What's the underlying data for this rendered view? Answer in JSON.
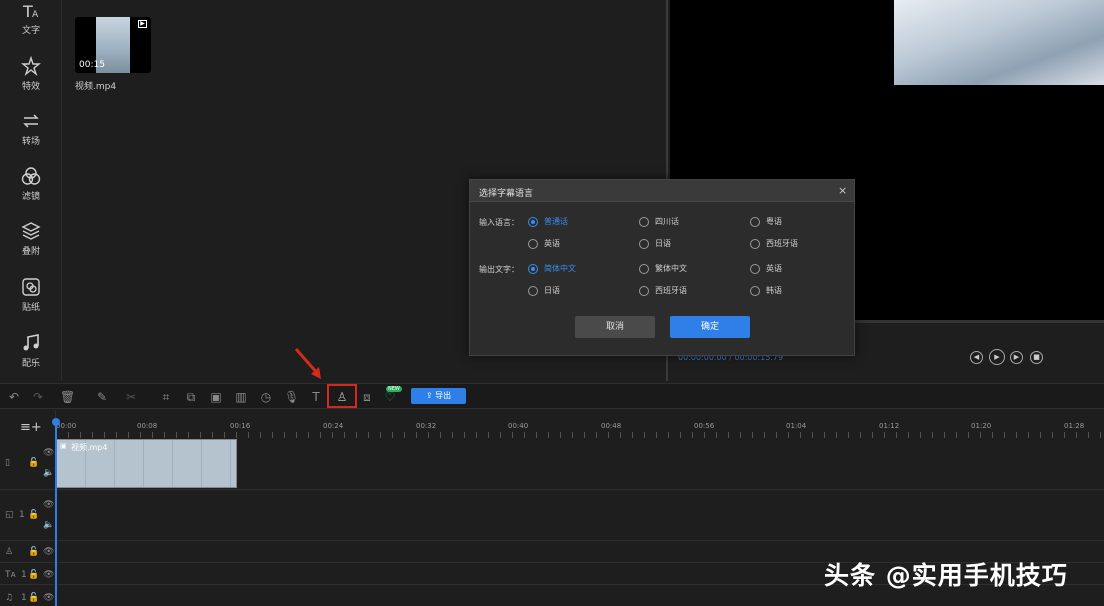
{
  "sidebar": {
    "items": [
      {
        "label": "文字",
        "icon": "text-icon"
      },
      {
        "label": "特效",
        "icon": "effects-icon"
      },
      {
        "label": "转场",
        "icon": "transition-icon"
      },
      {
        "label": "滤镜",
        "icon": "filter-icon"
      },
      {
        "label": "叠附",
        "icon": "overlay-icon"
      },
      {
        "label": "贴纸",
        "icon": "sticker-icon"
      },
      {
        "label": "配乐",
        "icon": "music-icon"
      }
    ]
  },
  "media": {
    "file_name": "视频.mp4",
    "duration": "00:15"
  },
  "preview": {
    "time_readout": "00:00:00.00 / 00:00:15.79"
  },
  "dialog": {
    "title": "选择字幕语言",
    "close": "×",
    "input_label": "输入语言：",
    "input_options": [
      "普通话",
      "四川话",
      "粤语",
      "英语",
      "日语",
      "西班牙语"
    ],
    "output_label": "输出文字：",
    "output_options": [
      "简体中文",
      "繁体中文",
      "英语",
      "日语",
      "西班牙语",
      "韩语"
    ],
    "selected_input": "普通话",
    "selected_output": "简体中文",
    "cancel_label": "取消",
    "ok_label": "确定"
  },
  "toolbar": {
    "export_label": "导出",
    "new_badge": "NEW"
  },
  "timeline": {
    "ticks": [
      "00:00",
      "00:08",
      "00:16",
      "00:24",
      "00:32",
      "00:40",
      "00:48",
      "00:56",
      "01:04",
      "01:12",
      "01:20",
      "01:28"
    ],
    "clip_name": "视频.mp4",
    "track_numbers": [
      "1",
      "1",
      "1"
    ]
  },
  "watermark": "头条 @实用手机技巧",
  "colors": {
    "accent": "#2e7fe8",
    "highlight_box": "#d42a1e",
    "arrow": "#d42a1e"
  }
}
